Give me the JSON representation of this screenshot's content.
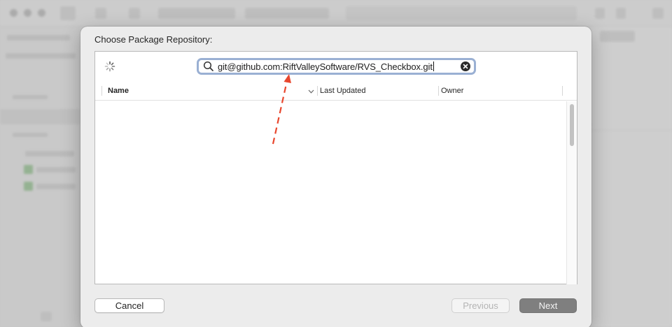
{
  "dialog": {
    "title": "Choose Package Repository:",
    "search": {
      "value": "git@github.com:RiftValleySoftware/RVS_Checkbox.git",
      "icon": "search-icon",
      "clear_icon": "clear-icon"
    },
    "loading_icon": "spinner-icon",
    "columns": [
      {
        "label": "Name",
        "sorted": true,
        "sort_direction": "descending"
      },
      {
        "label": "Last Updated"
      },
      {
        "label": "Owner"
      }
    ],
    "rows": [],
    "buttons": {
      "cancel": "Cancel",
      "previous": "Previous",
      "next": "Next"
    },
    "annotation": {
      "type": "dashed-arrow",
      "color": "#e8472e",
      "target": "search-field"
    }
  }
}
